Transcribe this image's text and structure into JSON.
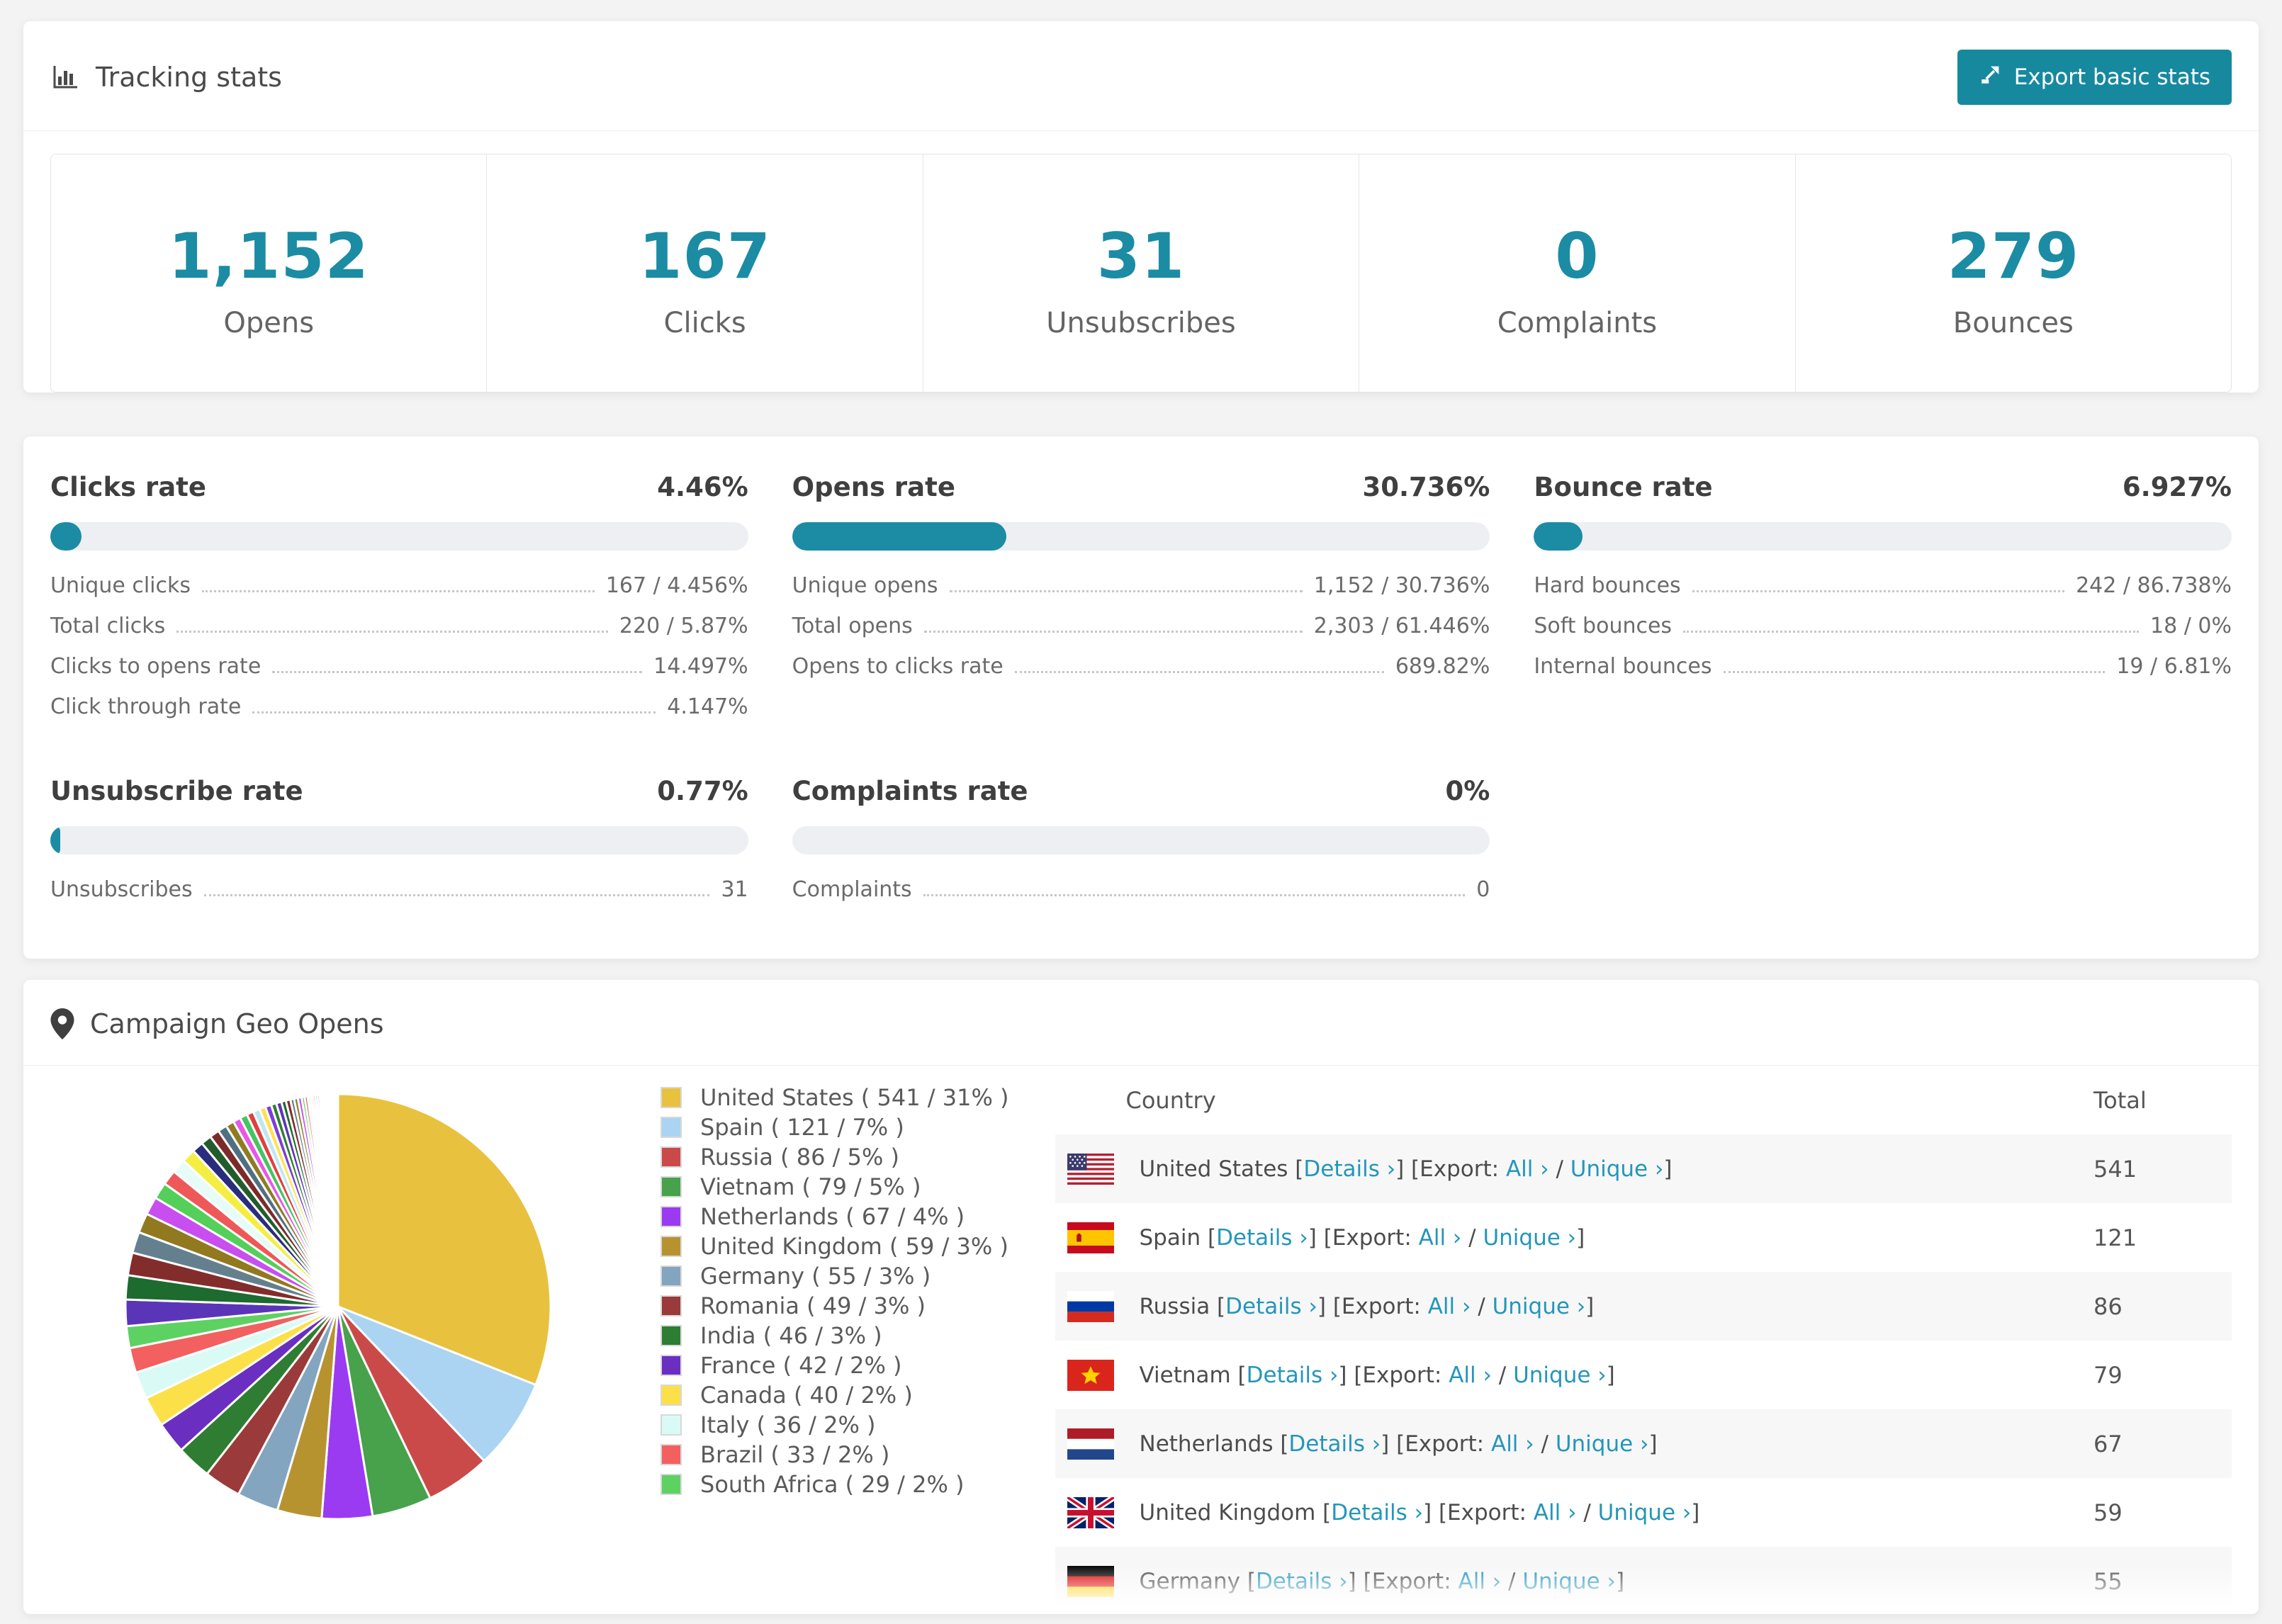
{
  "theme": {
    "accent": "#1b8ca4",
    "button": "#17899f",
    "link": "#2496ba",
    "track": "#edeff2",
    "stripe": "#f7f7f8"
  },
  "tracking": {
    "title": "Tracking stats",
    "export_button": "Export basic stats",
    "stats": [
      {
        "value": "1,152",
        "label": "Opens"
      },
      {
        "value": "167",
        "label": "Clicks"
      },
      {
        "value": "31",
        "label": "Unsubscribes"
      },
      {
        "value": "0",
        "label": "Complaints"
      },
      {
        "value": "279",
        "label": "Bounces"
      }
    ]
  },
  "rates": [
    {
      "title": "Clicks rate",
      "value": "4.46%",
      "percent": 4.46,
      "rows": [
        {
          "label": "Unique clicks",
          "value": "167 / 4.456%"
        },
        {
          "label": "Total clicks",
          "value": "220 / 5.87%"
        },
        {
          "label": "Clicks to opens rate",
          "value": "14.497%"
        },
        {
          "label": "Click through rate",
          "value": "4.147%"
        }
      ]
    },
    {
      "title": "Opens rate",
      "value": "30.736%",
      "percent": 30.736,
      "rows": [
        {
          "label": "Unique opens",
          "value": "1,152 / 30.736%"
        },
        {
          "label": "Total opens",
          "value": "2,303 / 61.446%"
        },
        {
          "label": "Opens to clicks rate",
          "value": "689.82%"
        }
      ]
    },
    {
      "title": "Bounce rate",
      "value": "6.927%",
      "percent": 6.927,
      "rows": [
        {
          "label": "Hard bounces",
          "value": "242 / 86.738%"
        },
        {
          "label": "Soft bounces",
          "value": "18 / 0%"
        },
        {
          "label": "Internal bounces",
          "value": "19 / 6.81%"
        }
      ]
    },
    {
      "title": "Unsubscribe rate",
      "value": "0.77%",
      "percent": 0.77,
      "rows": [
        {
          "label": "Unsubscribes",
          "value": "31"
        }
      ]
    },
    {
      "title": "Complaints rate",
      "value": "0%",
      "percent": 0,
      "rows": [
        {
          "label": "Complaints",
          "value": "0"
        }
      ]
    }
  ],
  "geo": {
    "title": "Campaign Geo Opens",
    "table": {
      "headers": [
        "Country",
        "Total"
      ],
      "link_labels": {
        "details": "Details",
        "export": "Export:",
        "all": "All",
        "unique": "Unique",
        "chevron": "›"
      },
      "rows": [
        {
          "flag": "us",
          "country": "United States",
          "total": "541"
        },
        {
          "flag": "es",
          "country": "Spain",
          "total": "121"
        },
        {
          "flag": "ru",
          "country": "Russia",
          "total": "86"
        },
        {
          "flag": "vn",
          "country": "Vietnam",
          "total": "79"
        },
        {
          "flag": "nl",
          "country": "Netherlands",
          "total": "67"
        },
        {
          "flag": "gb",
          "country": "United Kingdom",
          "total": "59"
        },
        {
          "flag": "de",
          "country": "Germany",
          "total": "55"
        }
      ]
    }
  },
  "chart_data": {
    "type": "pie",
    "title": "Campaign Geo Opens",
    "legend_position": "right",
    "start_angle_deg": 0,
    "direction": "clockwise",
    "slices": [
      {
        "label": "United States",
        "value": 541,
        "pct": 31,
        "color": "#e8c23e"
      },
      {
        "label": "Spain",
        "value": 121,
        "pct": 7,
        "color": "#abd3f2"
      },
      {
        "label": "Russia",
        "value": 86,
        "pct": 5,
        "color": "#ca4a4a"
      },
      {
        "label": "Vietnam",
        "value": 79,
        "pct": 5,
        "color": "#47a24b"
      },
      {
        "label": "Netherlands",
        "value": 67,
        "pct": 4,
        "color": "#9a3bf2"
      },
      {
        "label": "United Kingdom",
        "value": 59,
        "pct": 3,
        "color": "#b79330"
      },
      {
        "label": "Germany",
        "value": 55,
        "pct": 3,
        "color": "#83a5bf"
      },
      {
        "label": "Romania",
        "value": 49,
        "pct": 3,
        "color": "#9a3a3a"
      },
      {
        "label": "India",
        "value": 46,
        "pct": 3,
        "color": "#2e7d32"
      },
      {
        "label": "France",
        "value": 42,
        "pct": 2,
        "color": "#6a2fc0"
      },
      {
        "label": "Canada",
        "value": 40,
        "pct": 2,
        "color": "#fbe04a"
      },
      {
        "label": "Italy",
        "value": 36,
        "pct": 2,
        "color": "#dafbf5"
      },
      {
        "label": "Brazil",
        "value": 33,
        "pct": 2,
        "color": "#f26060"
      },
      {
        "label": "South Africa",
        "value": 29,
        "pct": 2,
        "color": "#5ed163"
      }
    ],
    "others_estimated": [
      35,
      32,
      30,
      28,
      26,
      24,
      22,
      20,
      19,
      18,
      15,
      14,
      13,
      12,
      11,
      10,
      10,
      9,
      9,
      8,
      8,
      7,
      7,
      6,
      6,
      5,
      5,
      5,
      4,
      4,
      4,
      3,
      3,
      3,
      3,
      2,
      2,
      2,
      2,
      2,
      2,
      2,
      2,
      1,
      1,
      1,
      1,
      1,
      1,
      1,
      1
    ],
    "others_palette": [
      "#5b35b8",
      "#1d6b2f",
      "#832c2c",
      "#64808f",
      "#91791f",
      "#c84ef0",
      "#54cf5a",
      "#ef5858",
      "#e7fbf7",
      "#f4ee43",
      "#2a2d7d",
      "#235c2c",
      "#7d2a2a",
      "#507082",
      "#8f7c22",
      "#e858e8",
      "#46c463",
      "#e04040",
      "#bfe6f2",
      "#ffe14d",
      "#7b3fd6",
      "#2e7d32"
    ]
  }
}
